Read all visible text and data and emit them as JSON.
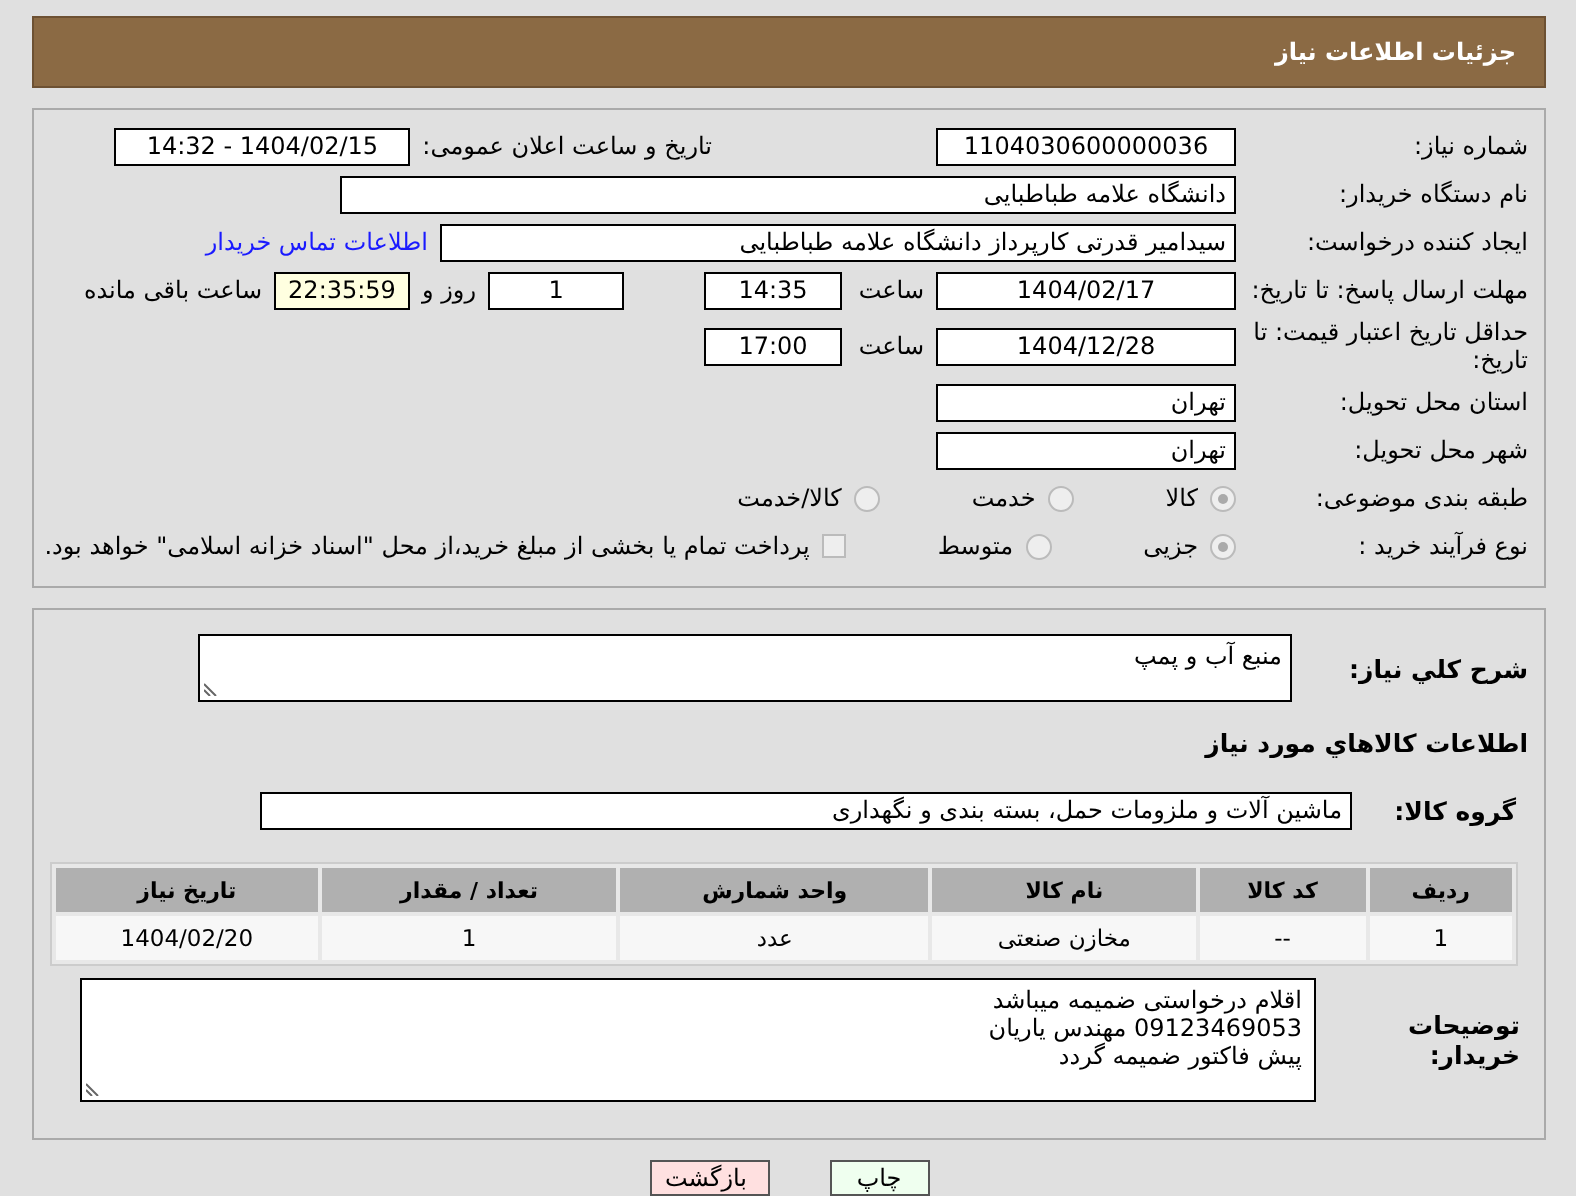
{
  "header": {
    "title": "جزئیات اطلاعات نیاز"
  },
  "need_number": {
    "label": "شماره نیاز:",
    "value": "1104030600000036"
  },
  "announce": {
    "label": "تاریخ و ساعت اعلان عمومی:",
    "value": "1404/02/15 - 14:32"
  },
  "buyer_org": {
    "label": "نام دستگاه خریدار:",
    "value": "دانشگاه علامه طباطبایی"
  },
  "requester": {
    "label": "ایجاد کننده درخواست:",
    "value": "سیدامیر قدرتی کارپرداز دانشگاه علامه طباطبایی",
    "link": "اطلاعات تماس خریدار"
  },
  "reply_deadline": {
    "label": "مهلت ارسال پاسخ: تا تاریخ:",
    "date": "1404/02/17",
    "time_label": "ساعت",
    "time": "14:35",
    "days": "1",
    "days_label": "روز و",
    "remaining": "22:35:59",
    "remaining_label": "ساعت باقی مانده"
  },
  "price_validity": {
    "label": "حداقل تاریخ اعتبار قیمت: تا تاریخ:",
    "date": "1404/12/28",
    "time_label": "ساعت",
    "time": "17:00"
  },
  "province": {
    "label": "استان محل تحویل:",
    "value": "تهران"
  },
  "city": {
    "label": "شهر محل تحویل:",
    "value": "تهران"
  },
  "category": {
    "label": "طبقه بندی موضوعی:",
    "options": [
      {
        "label": "کالا",
        "selected": true
      },
      {
        "label": "خدمت",
        "selected": false
      },
      {
        "label": "کالا/خدمت",
        "selected": false
      }
    ]
  },
  "purchase_process": {
    "label": "نوع فرآیند خرید :",
    "options": [
      {
        "label": "جزیی",
        "selected": true
      },
      {
        "label": "متوسط",
        "selected": false
      }
    ],
    "treasury": {
      "label": "پرداخت تمام یا بخشی از مبلغ خرید،از محل \"اسناد خزانه اسلامی\" خواهد بود.",
      "checked": false
    }
  },
  "description": {
    "label": "شرح کلي نياز:",
    "value": "منبع آب و پمپ"
  },
  "goods_title": "اطلاعات کالاهاي مورد نياز",
  "goods_group": {
    "label": "گروه کالا:",
    "value": "ماشین آلات و ملزومات حمل، بسته بندی و نگهداری"
  },
  "table": {
    "columns": [
      "ردیف",
      "کد کالا",
      "نام کالا",
      "واحد شمارش",
      "تعداد / مقدار",
      "تاریخ نیاز"
    ],
    "rows": [
      [
        "1",
        "--",
        "مخازن صنعتی",
        "عدد",
        "1",
        "1404/02/20"
      ]
    ]
  },
  "buyer_notes": {
    "label": "توضیحات خریدار:",
    "lines": [
      "اقلام درخواستی ضمیمه میباشد",
      "09123469053 مهندس یاریان",
      "پیش فاکتور ضمیمه گردد"
    ]
  },
  "buttons": [
    {
      "label": "چاپ",
      "kind": "print"
    },
    {
      "label": "بازگشت",
      "kind": "back"
    }
  ]
}
